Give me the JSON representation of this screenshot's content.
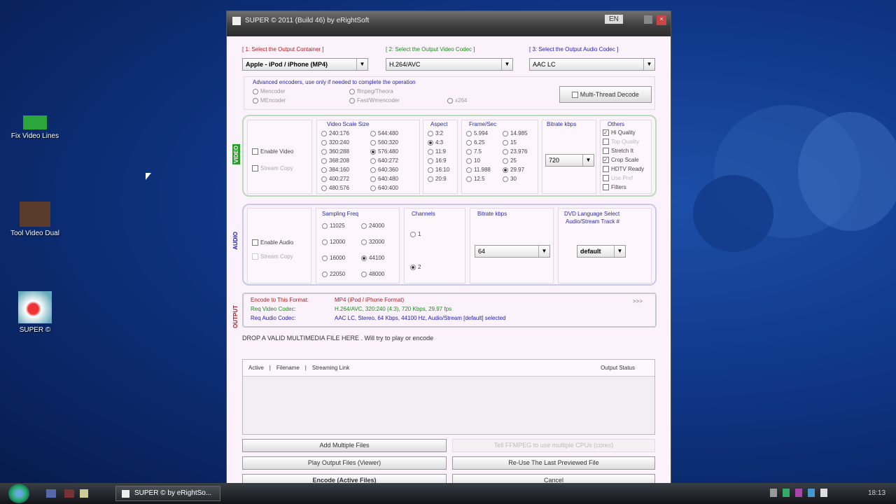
{
  "desktop": {
    "icons": [
      "Fix Video Lines",
      "Tool Video Dual",
      "SUPER ©"
    ]
  },
  "window": {
    "title": "SUPER © 2011 (Build 46) by eRightSoft",
    "title_badge": "EN",
    "headers": {
      "container": "[ 1:  Select the Output Container ]",
      "video_codec": "[ 2:  Select the Output Video Codec ]",
      "audio_codec": "[ 3:  Select the Output Audio Codec ]"
    },
    "container_value": "Apple - iPod / iPhone (MP4)",
    "video_codec_value": "H.264/AVC",
    "audio_codec_value": "AAC LC",
    "advanced": {
      "text": "Advanced encoders, use only if needed to complete the operation",
      "opts": [
        "Mencoder",
        "ffmpeg/Theora",
        "MEncoder",
        "Fast/Wmencoder",
        "x264"
      ],
      "multithread": "Multi-Thread Decode"
    },
    "video": {
      "label": "VIDEO",
      "enable": "Enable Video",
      "stream_copy": "Stream Copy",
      "scale_title": "Video Scale Size",
      "scale": [
        "240:176",
        "320:240",
        "360:288",
        "368:208",
        "384:160",
        "400:272",
        "480:576",
        "544:480",
        "560:320",
        "576:480",
        "640:272",
        "640:360",
        "640:480",
        "640:400"
      ],
      "scale_selected": "576:480",
      "aspect_title": "Aspect",
      "aspect": [
        "3:2",
        "4:3",
        "11:9",
        "16:9",
        "16:10",
        "20:9"
      ],
      "aspect_selected": "4:3",
      "fps_title": "Frame/Sec",
      "fps": [
        "5.994",
        "6.25",
        "7.5",
        "10",
        "11.988",
        "12.5",
        "14.985",
        "15",
        "23.976",
        "25",
        "29.97",
        "30"
      ],
      "fps_selected": "29.97",
      "bitrate_title": "Bitrate kbps",
      "bitrate": "720",
      "others_title": "Others",
      "others": [
        "Hi Quality",
        "Top Quality",
        "Stretch It",
        "Crop Scale",
        "HDTV Ready",
        "Use Pref",
        "Filters"
      ]
    },
    "audio": {
      "label": "AUDIO",
      "enable": "Enable Audio",
      "stream_copy": "Stream Copy",
      "freq_title": "Sampling Freq",
      "freq": [
        "11025",
        "24000",
        "12000",
        "32000",
        "16000",
        "44100",
        "22050",
        "48000"
      ],
      "freq_selected": "44100",
      "channels_title": "Channels",
      "channels": [
        "1",
        "2"
      ],
      "channels_selected": "2",
      "bitrate_title": "Bitrate  kbps",
      "bitrate": "64",
      "dvd_title": "DVD Language Select",
      "dvd_sub": "Audio/Stream  Track #",
      "dvd_value": "default"
    },
    "output": {
      "label": "OUTPUT",
      "rows": [
        {
          "k": "Encode to This Format:",
          "v": "MP4  (iPod / iPhone Format)",
          "c": "#b02020"
        },
        {
          "k": "Req Video Codec:",
          "v": "H.264/AVC,  320:240 (4:3),  720 Kbps,  29.97 fps",
          "c": "#1e8a1e"
        },
        {
          "k": "Req Audio Codec:",
          "v": "AAC LC,  Stereo,  64 Kbps,  44100 Hz,  Audio/Stream [default] selected",
          "c": "#2222b0"
        }
      ],
      "more": ">>>"
    },
    "status": "DROP A VALID MULTIMEDIA FILE HERE . Will try to play or encode",
    "list": {
      "cols": [
        "Active",
        "Filename",
        "Streaming Link"
      ],
      "status_col": "Output Status"
    },
    "buttons": [
      "Add Multiple Files",
      "Tell FFMPEG to use multiple CPUs (cores)",
      "Play Output Files (Viewer)",
      "Re-Use The Last Previewed File",
      "Encode (Active Files)",
      "Cancel"
    ]
  },
  "taskbar": {
    "task": "SUPER © by eRightSo...",
    "clock": "18:13"
  }
}
